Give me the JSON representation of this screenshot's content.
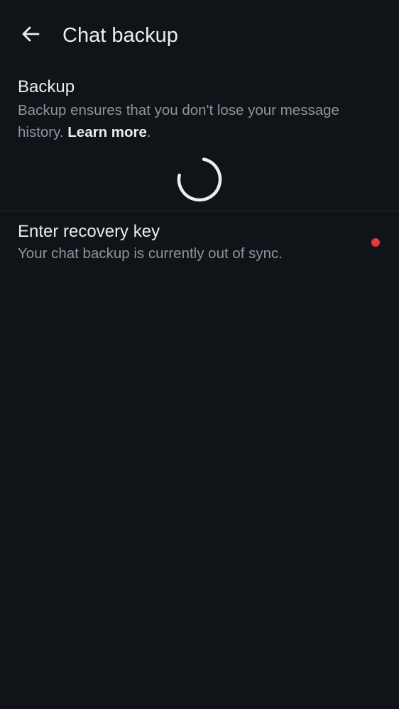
{
  "header": {
    "title": "Chat backup",
    "back_icon": "arrow-left-icon"
  },
  "backup_section": {
    "title": "Backup",
    "description": "Backup ensures that you don't lose your message history.",
    "learn_more": "Learn more",
    "trailing_period": ".",
    "loading_icon": "spinner-icon"
  },
  "recovery_section": {
    "title": "Enter recovery key",
    "description": "Your chat backup is currently out of sync.",
    "status_indicator": "alert-dot-icon"
  },
  "colors": {
    "background": "#101318",
    "primary_text": "#ECEDEF",
    "secondary_text": "#8E949D",
    "divider": "#24272D",
    "alert": "#E5373F",
    "spinner": "#ECEDEF"
  }
}
